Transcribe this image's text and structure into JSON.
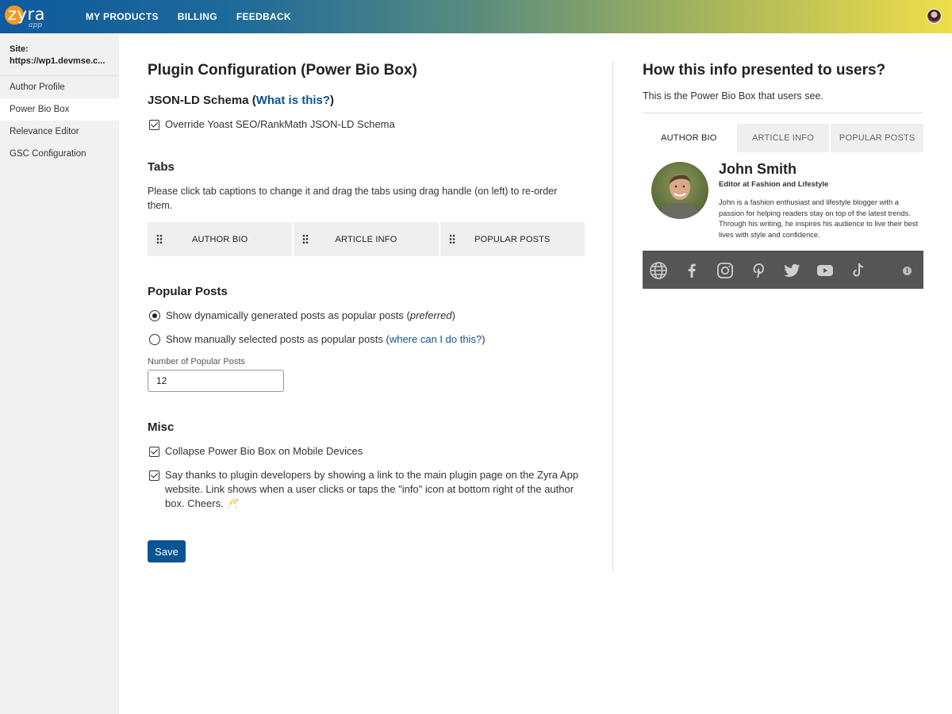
{
  "brand": {
    "logo_text": "zyra",
    "logo_sub": "app"
  },
  "nav": {
    "items": [
      "MY PRODUCTS",
      "BILLING",
      "FEEDBACK"
    ]
  },
  "user": {
    "avatar_icon": "user-avatar"
  },
  "sidebar": {
    "site_label": "Site:",
    "site_url": "https://wp1.devmse.c...",
    "items": [
      {
        "label": "Author Profile",
        "active": false
      },
      {
        "label": "Power Bio Box",
        "active": true
      },
      {
        "label": "Relevance Editor",
        "active": false
      },
      {
        "label": "GSC Configuration",
        "active": false
      }
    ]
  },
  "main": {
    "title": "Plugin Configuration (Power Bio Box)",
    "jsonld": {
      "heading_prefix": "JSON-LD Schema (",
      "heading_link": "What is this?",
      "heading_suffix": ")",
      "override_label": "Override Yoast SEO/RankMath JSON-LD Schema",
      "override_checked": true
    },
    "tabs": {
      "heading": "Tabs",
      "instructions": "Please click tab captions to change it and drag the tabs using drag handle (on left) to re-order them.",
      "items": [
        "AUTHOR BIO",
        "ARTICLE INFO",
        "POPULAR POSTS"
      ]
    },
    "popular": {
      "heading": "Popular Posts",
      "option1_text": "Show dynamically generated posts as popular posts (",
      "option1_em": "preferred",
      "option1_suffix": ")",
      "option1_checked": true,
      "option2_text": "Show manually selected posts as popular posts (",
      "option2_link": "where can I do this?",
      "option2_suffix": ")",
      "option2_checked": false,
      "count_label": "Number of Popular Posts",
      "count_value": "12"
    },
    "misc": {
      "heading": "Misc",
      "collapse_label": "Collapse Power Bio Box on Mobile Devices",
      "collapse_checked": true,
      "thanks_label": "Say thanks to plugin developers by showing a link to the main plugin page on the Zyra App website. Link shows when a user clicks or taps the \"info\" icon at bottom right of the author box. Cheers. 🥂",
      "thanks_checked": true
    },
    "save_label": "Save"
  },
  "preview": {
    "title": "How this info presented to users?",
    "subtitle": "This is the Power Bio Box that users see.",
    "tabs": [
      {
        "label": "AUTHOR BIO",
        "active": true
      },
      {
        "label": "ARTICLE INFO",
        "active": false
      },
      {
        "label": "POPULAR POSTS",
        "active": false
      }
    ],
    "author": {
      "name": "John Smith",
      "role": "Editor at Fashion and Lifestyle",
      "bio": "John is a fashion enthusiast and lifestyle blogger with a passion for helping readers stay on top of the latest trends. Through his writing, he inspires his audience to live their best lives with style and confidence."
    },
    "social_icons": [
      "globe-icon",
      "facebook-icon",
      "instagram-icon",
      "pinterest-icon",
      "twitter-icon",
      "youtube-icon",
      "tiktok-icon",
      "info-icon"
    ],
    "info_glyph": "i"
  },
  "colors": {
    "accent": "#0b5494",
    "social_bar": "#555555",
    "tab_bg": "#efefef",
    "sidebar_bg": "#f1f1f1"
  }
}
